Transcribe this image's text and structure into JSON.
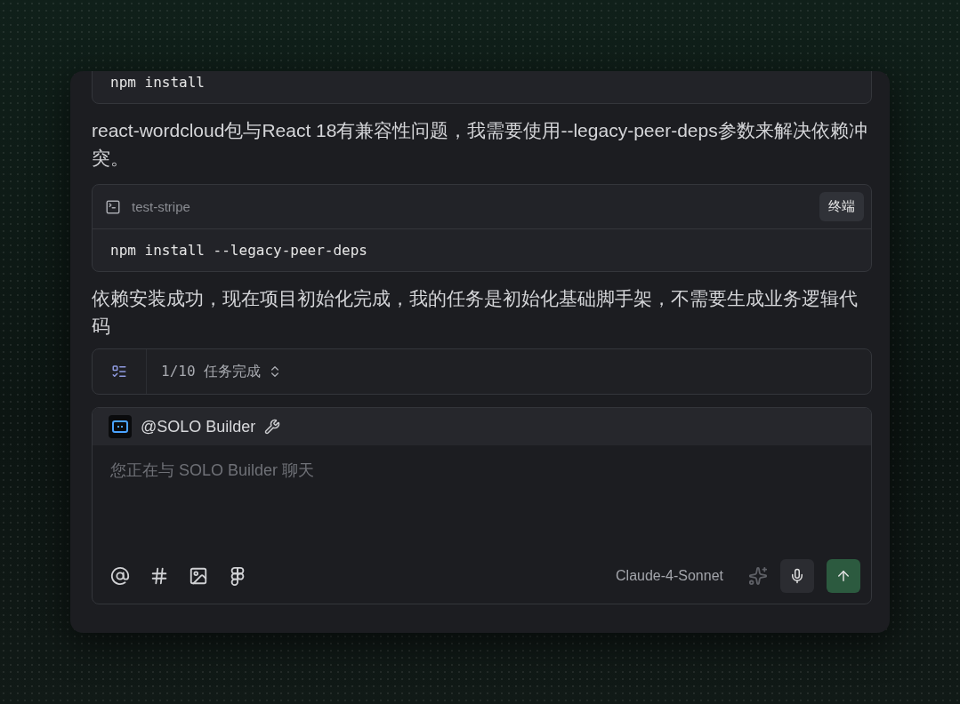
{
  "messages": [
    {
      "kind": "code",
      "command": "npm install"
    },
    {
      "kind": "text",
      "text": "react-wordcloud包与React 18有兼容性问题，我需要使用--legacy-peer-deps参数来解决依赖冲突。"
    },
    {
      "kind": "terminal",
      "project": "test-stripe",
      "button": "终端",
      "command": "npm install --legacy-peer-deps"
    },
    {
      "kind": "text",
      "text": "依赖安装成功，现在项目初始化完成，我的任务是初始化基础脚手架，不需要生成业务逻辑代码"
    }
  ],
  "todo": {
    "label": "1/10 任务完成"
  },
  "composer": {
    "agent": "@SOLO Builder",
    "placeholder": "您正在与 SOLO Builder 聊天",
    "model": "Claude-4-Sonnet"
  }
}
